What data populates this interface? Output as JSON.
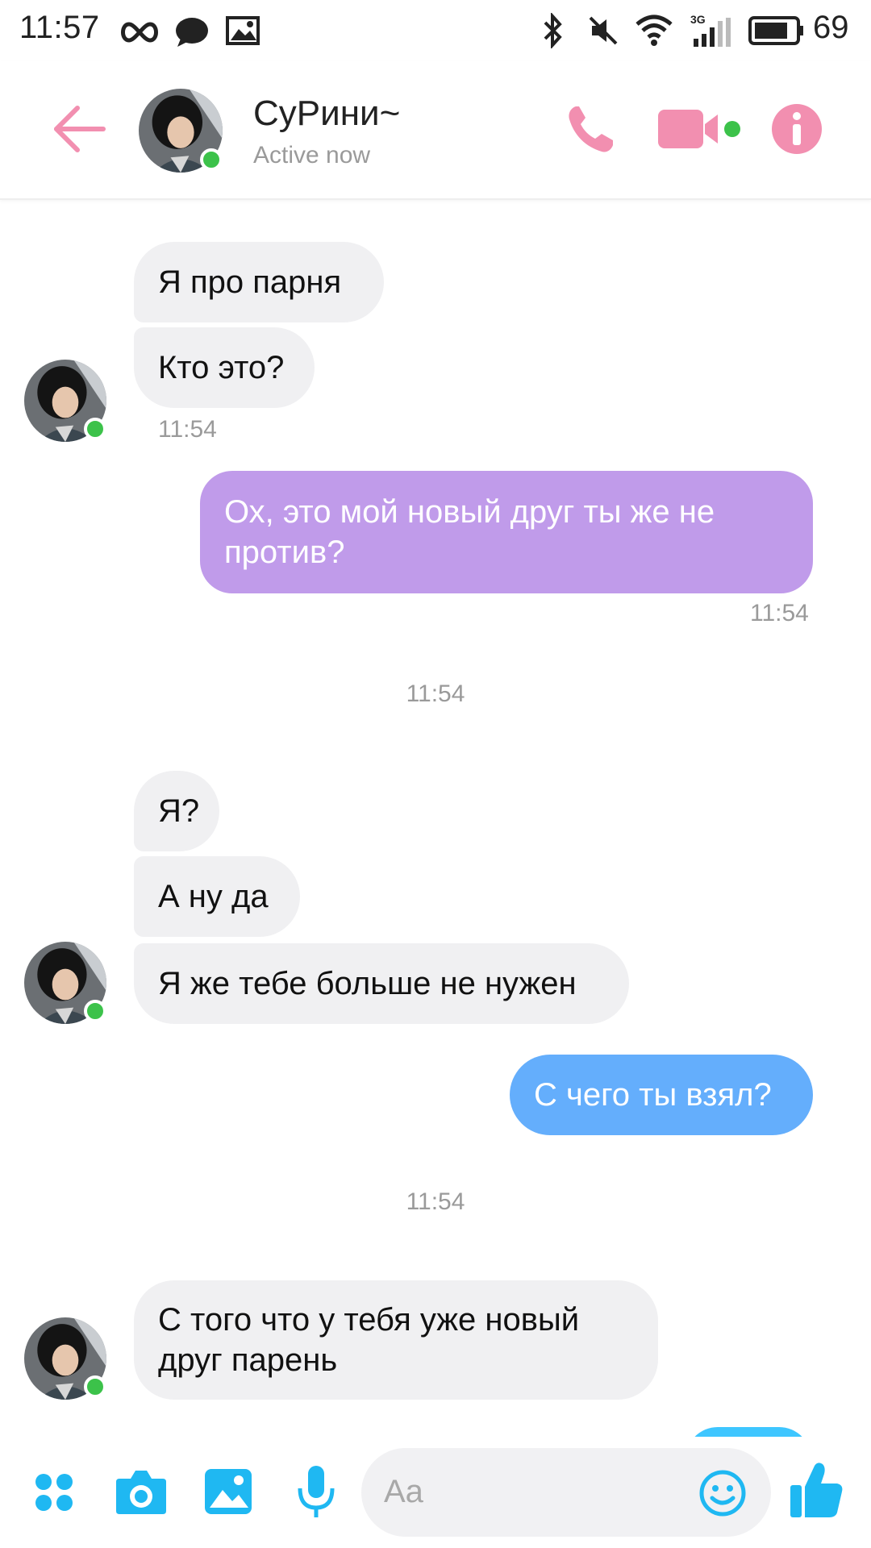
{
  "status_bar": {
    "time": "11:57",
    "battery": "69",
    "network": "3G",
    "icons": [
      "infinity-icon",
      "chat-bubble-icon",
      "image-icon",
      "bluetooth-icon",
      "mute-icon",
      "wifi-icon",
      "signal-icon",
      "battery-icon"
    ]
  },
  "header": {
    "contact_name": "СуРини~",
    "status": "Active now",
    "icons": [
      "back-arrow-icon",
      "phone-icon",
      "video-camera-icon",
      "info-icon"
    ],
    "accent_color": "#f28fb0",
    "online_color": "#3cc24a"
  },
  "messages": [
    {
      "side": "in",
      "text": "Я про парня"
    },
    {
      "side": "in",
      "text": "Кто это?",
      "time": "11:54"
    },
    {
      "side": "out",
      "text": "Ох, это мой новый друг ты же не против?",
      "time": "11:54",
      "color": "#c09bea"
    },
    {
      "divider": "11:54"
    },
    {
      "side": "in",
      "text": "Я?"
    },
    {
      "side": "in",
      "text": "А ну да"
    },
    {
      "side": "in",
      "text": "Я же тебе больше не нужен"
    },
    {
      "side": "out",
      "text": "С чего ты взял?",
      "color": "#64aefc"
    },
    {
      "divider": "11:54"
    },
    {
      "side": "in",
      "text": "С того что у тебя уже новый друг парень"
    }
  ],
  "composer": {
    "placeholder": "Aa",
    "icons": [
      "apps-grid-icon",
      "camera-icon",
      "gallery-icon",
      "microphone-icon",
      "emoji-icon",
      "thumbs-up-icon"
    ],
    "accent_color": "#1fb8f2"
  }
}
